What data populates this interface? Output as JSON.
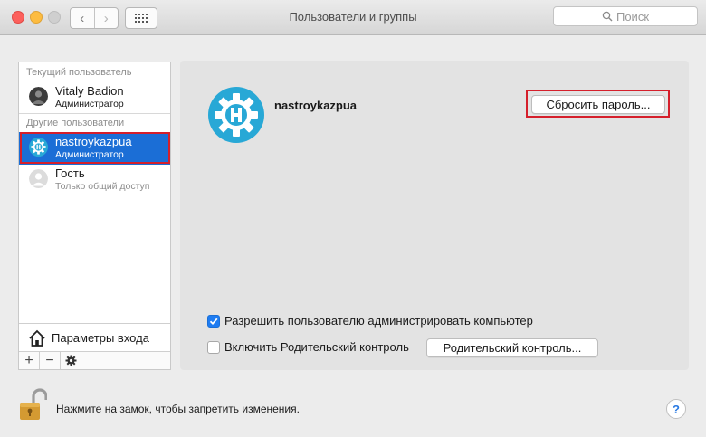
{
  "window": {
    "title": "Пользователи и группы"
  },
  "toolbar": {
    "back_icon": "chevron-left-icon",
    "forward_icon": "chevron-right-icon",
    "grid_icon": "show-all-grid-icon"
  },
  "search": {
    "placeholder": "Поиск"
  },
  "sidebar": {
    "current_section": "Текущий пользователь",
    "other_section": "Другие пользователи",
    "users": [
      {
        "name": "Vitaly Badion",
        "role": "Администратор",
        "selected": false
      },
      {
        "name": "nastroykazpua",
        "role": "Администратор",
        "selected": true
      },
      {
        "name": "Гость",
        "role": "Только общий доступ",
        "selected": false
      }
    ],
    "login_options": "Параметры входа",
    "add_icon": "plus-icon",
    "remove_icon": "minus-icon",
    "actions_icon": "gear-icon"
  },
  "detail": {
    "username": "nastroykazpua",
    "reset_password_button": "Сбросить пароль...",
    "allow_admin_label": "Разрешить пользователю администрировать компьютер",
    "allow_admin_checked": true,
    "parental_label": "Включить Родительский контроль",
    "parental_checked": false,
    "parental_button": "Родительский контроль..."
  },
  "footer": {
    "lock_text": "Нажмите на замок, чтобы запретить изменения.",
    "help_label": "?"
  },
  "colors": {
    "selection": "#1b6ed6",
    "highlight_box": "#d51f2b",
    "avatar_teal": "#28a8d6",
    "checkbox_blue": "#1e7cf2"
  }
}
